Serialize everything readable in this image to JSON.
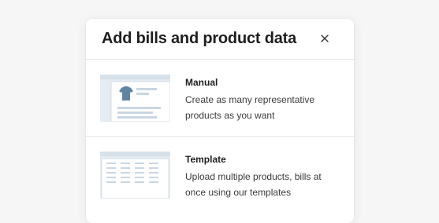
{
  "modal": {
    "title": "Add bills and product data",
    "close_icon": "close-icon",
    "options": [
      {
        "title": "Manual",
        "description": "Create as many representative products as you want",
        "icon": "tshirt-card-illustration"
      },
      {
        "title": "Template",
        "description": "Upload multiple products, bills at once using our templates",
        "icon": "spreadsheet-template-illustration"
      }
    ]
  },
  "colors": {
    "illustration_bg": "#e4ebf1",
    "illustration_accent": "#5f84a4",
    "divider": "#e6e6e6"
  }
}
